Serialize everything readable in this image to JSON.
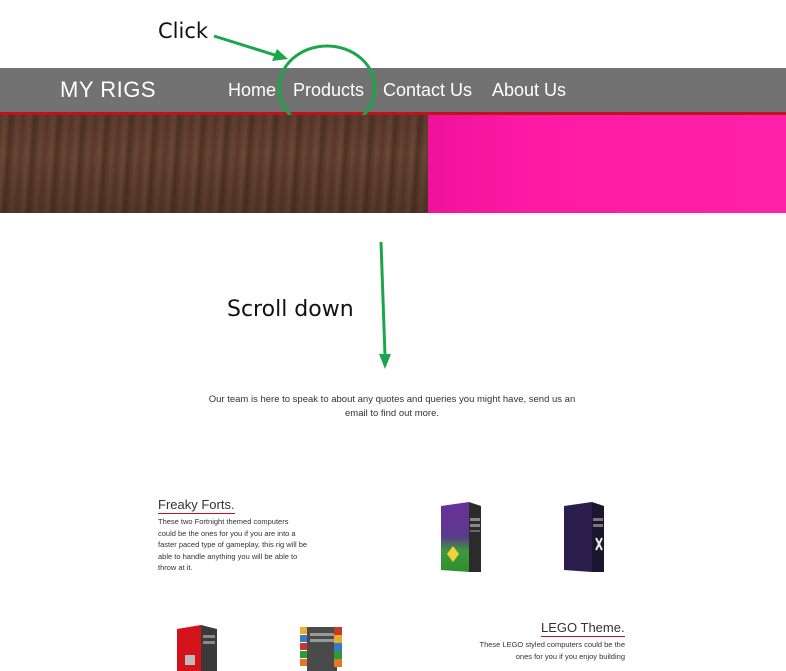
{
  "annotations": {
    "click_label": "Click",
    "scroll_label": "Scroll down",
    "accent_color": "#1ca64c"
  },
  "navbar": {
    "brand": "MY RIGS",
    "links": [
      "Home",
      "Products",
      "Contact Us",
      "About Us"
    ],
    "background_color": "#727272",
    "border_color": "#c0121a"
  },
  "hero": {
    "left_color": "#5b3b2c",
    "right_color": "#ff1aa4"
  },
  "intro_text": "Our team is here to speak to about any quotes and queries you might have, send us an email to find out more.",
  "sections": [
    {
      "title": "Freaky Forts.",
      "text": "These two Fortnight themed computers could be the ones for you if you are into a faster paced type of gameplay, this rig will be able to handle anything you will be able to throw at it.",
      "images": [
        "purple-green-pc-image",
        "dark-purple-pc-image"
      ]
    },
    {
      "title": "LEGO Theme.",
      "text": "These LEGO styled computers could be the ones for you if you enjoy building",
      "images": [
        "red-lego-pc-image",
        "multicolor-lego-pc-image"
      ]
    }
  ]
}
